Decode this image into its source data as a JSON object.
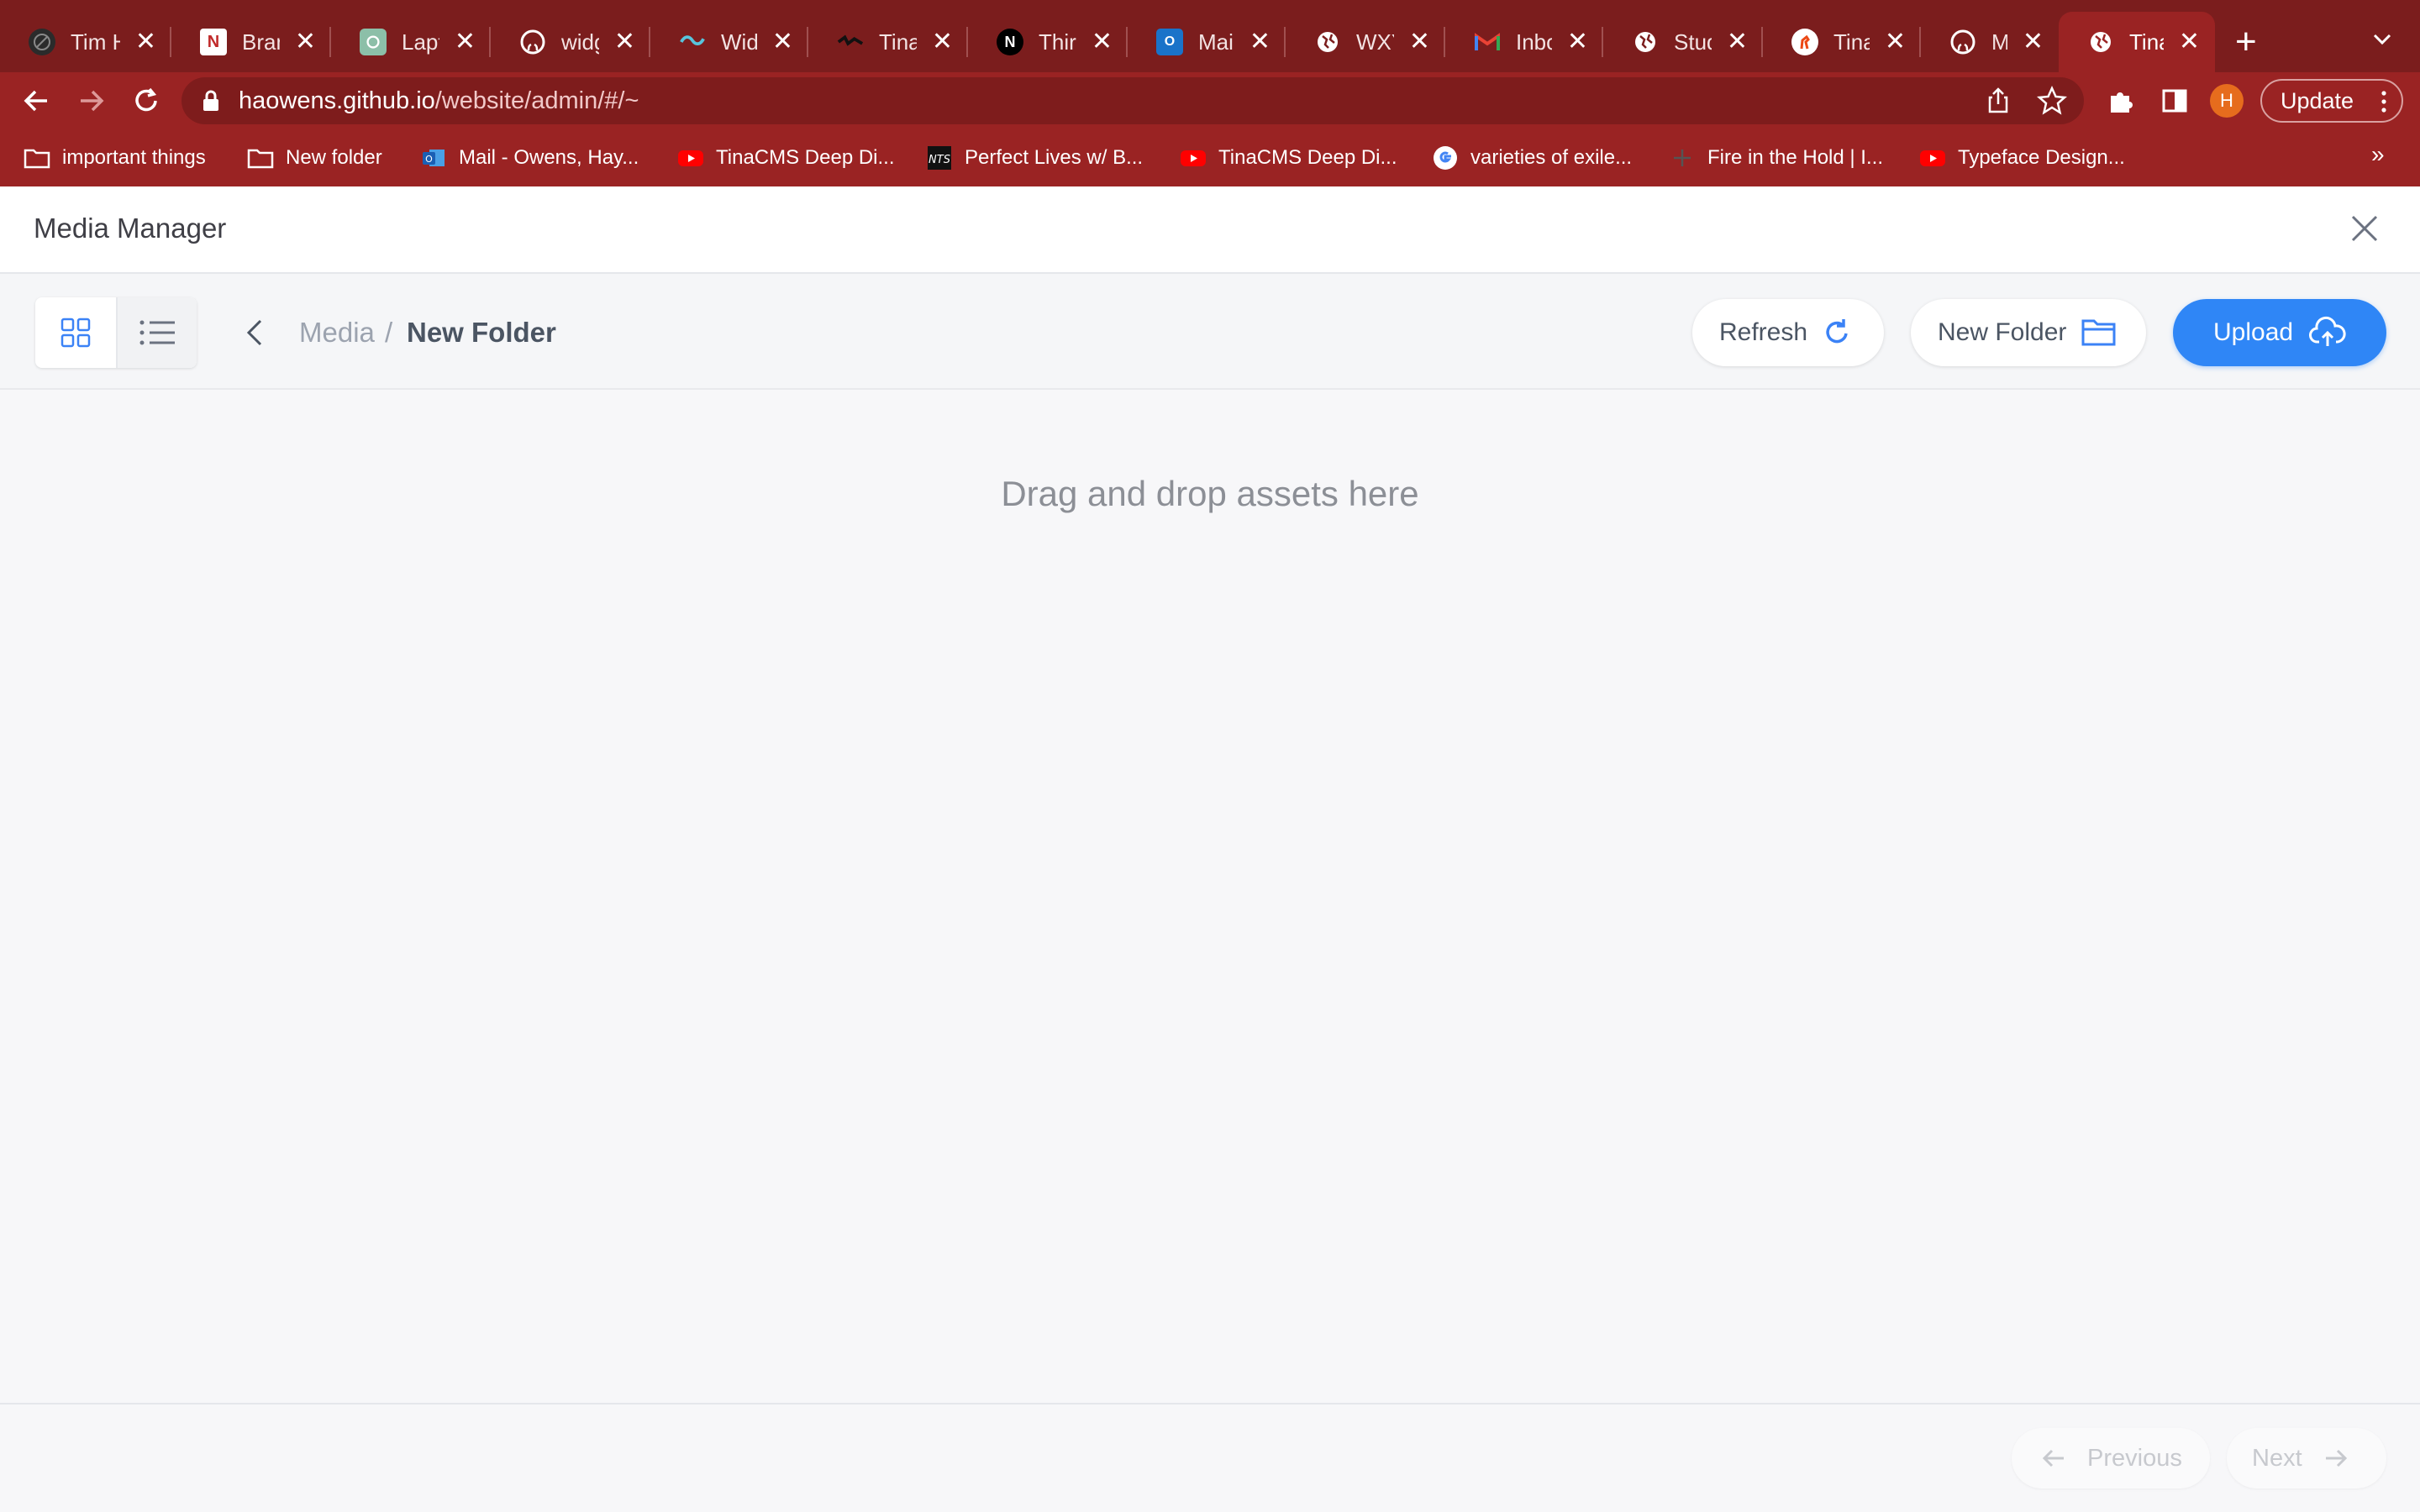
{
  "browser": {
    "tabs": [
      {
        "label": "Tim H",
        "favicon": "circle-slash-icon",
        "active": false
      },
      {
        "label": "Brand",
        "favicon": "notion-icon",
        "active": false
      },
      {
        "label": "Lapto",
        "favicon": "openai-icon",
        "active": false
      },
      {
        "label": "widg",
        "favicon": "github-icon",
        "active": false
      },
      {
        "label": "Widtl",
        "favicon": "tailwind-icon",
        "active": false
      },
      {
        "label": "TinaC",
        "favicon": "tina-llama-icon",
        "active": false
      },
      {
        "label": "Third",
        "favicon": "nextjs-icon",
        "active": false
      },
      {
        "label": "Mail",
        "favicon": "outlook-icon",
        "active": false
      },
      {
        "label": "WXY",
        "favicon": "globe-icon",
        "active": false
      },
      {
        "label": "Inbox",
        "favicon": "gmail-icon",
        "active": false
      },
      {
        "label": "Stud",
        "favicon": "globe-icon",
        "active": false
      },
      {
        "label": "Tina",
        "favicon": "llama-icon",
        "active": false
      },
      {
        "label": "Merg",
        "favicon": "github-icon",
        "active": false
      },
      {
        "label": "TinaC",
        "favicon": "globe-icon",
        "active": true
      }
    ],
    "new_tab": "+",
    "url": {
      "host": "haowens.github.io",
      "path": "/website/admin/#/~"
    },
    "profile_initial": "H",
    "update_label": "Update",
    "bookmarks": [
      {
        "label": "important things",
        "icon": "folder-icon"
      },
      {
        "label": "New folder",
        "icon": "folder-icon"
      },
      {
        "label": "Mail - Owens, Hay...",
        "icon": "outlook-icon"
      },
      {
        "label": "TinaCMS Deep Di...",
        "icon": "youtube-icon"
      },
      {
        "label": "Perfect Lives w/ B...",
        "icon": "nts-icon"
      },
      {
        "label": "TinaCMS Deep Di...",
        "icon": "youtube-icon"
      },
      {
        "label": "varieties of exile...",
        "icon": "google-icon"
      },
      {
        "label": "Fire in the Hold | I...",
        "icon": "cross-icon"
      },
      {
        "label": "Typeface Design...",
        "icon": "youtube-icon"
      }
    ],
    "bookmarks_more": "»",
    "colors": {
      "frame": "#7b1d1d",
      "toolbar": "#9a2323",
      "profile": "#e66c1d"
    }
  },
  "media_manager": {
    "title": "Media Manager",
    "breadcrumb": {
      "root": "Media",
      "separator": "/",
      "current": "New Folder"
    },
    "actions": {
      "refresh": "Refresh",
      "new_folder": "New Folder",
      "upload": "Upload"
    },
    "empty_message": "Drag and drop assets here",
    "pagination": {
      "previous": "Previous",
      "next": "Next"
    },
    "colors": {
      "accent": "#2f86f6",
      "breadcrumb_muted": "#9ca3af"
    }
  }
}
